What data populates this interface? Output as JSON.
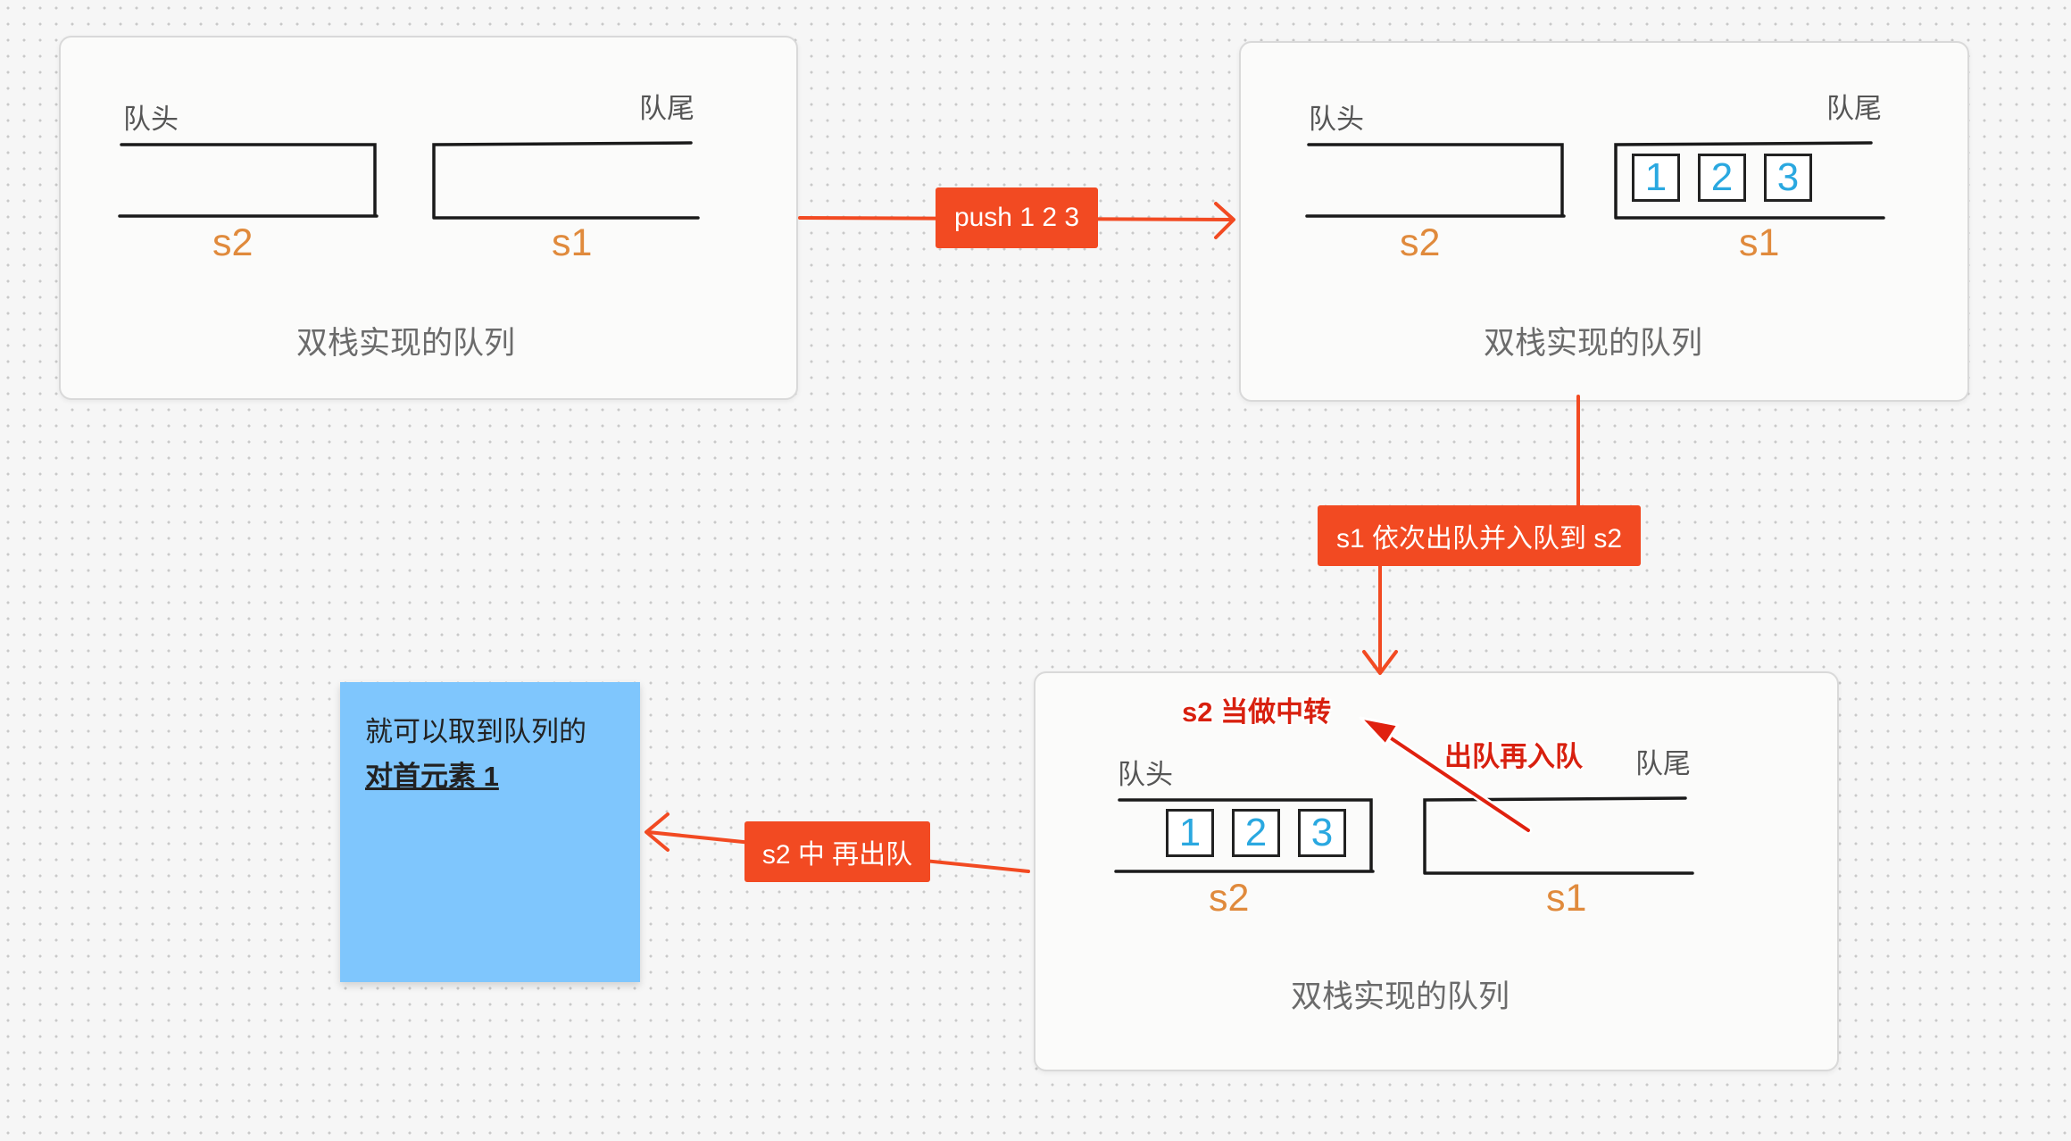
{
  "cards": [
    {
      "head_label": "队头",
      "tail_label": "队尾",
      "left_stack": "s2",
      "right_stack": "s1",
      "title": "双栈实现的队列",
      "left_items": [],
      "right_items": []
    },
    {
      "head_label": "队头",
      "tail_label": "队尾",
      "left_stack": "s2",
      "right_stack": "s1",
      "title": "双栈实现的队列",
      "left_items": [],
      "right_items": [
        "1",
        "2",
        "3"
      ]
    },
    {
      "head_label": "队头",
      "tail_label": "队尾",
      "left_stack": "s2",
      "right_stack": "s1",
      "title": "双栈实现的队列",
      "left_items": [
        "1",
        "2",
        "3"
      ],
      "right_items": []
    }
  ],
  "edges": {
    "push": "push 1 2 3",
    "transfer": "s1 依次出队并入队到 s2",
    "pop": "s2 中 再出队"
  },
  "annotations": {
    "relay": "s2 当做中转",
    "reenqueue": "出队再入队"
  },
  "note": {
    "line1": "就可以取到队列的",
    "line2": "对首元素 1"
  },
  "colors": {
    "accent": "#f24a22",
    "note_bg": "#7fc6fd",
    "item_text": "#2aa8e0",
    "stack_label": "#e08a3c"
  }
}
